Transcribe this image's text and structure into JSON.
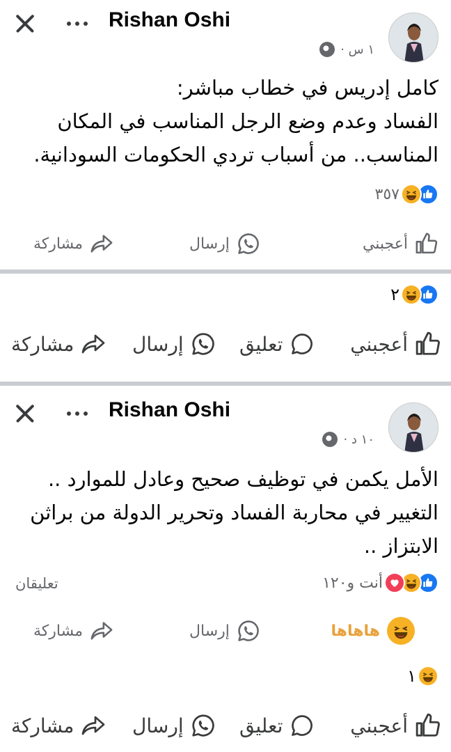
{
  "posts": [
    {
      "author": "Rishan Oshi",
      "time": "١ س ·",
      "text_lines": [
        "كامل إدريس في خطاب مباشر:",
        "الفساد وعدم وضع الرجل المناسب في المكان",
        "المناسب.. من أسباب تردي الحكومات السودانية."
      ],
      "reaction_count": "٣٥٧",
      "actions": {
        "like": "أعجبني",
        "send": "إرسال",
        "share": "مشاركة"
      }
    },
    {
      "author": "Rishan Oshi",
      "time": "١٠ د ·",
      "text_lines": [
        "الأمل يكمن في توظيف صحيح وعادل للموارد ..",
        "التغيير في محاربة الفساد وتحرير الدولة من براثن",
        "الابتزاز .."
      ],
      "reaction_count": "أنت و١٢٠",
      "comments": "تعليقان",
      "actions": {
        "haha": "هاهاها",
        "send": "إرسال",
        "share": "مشاركة"
      }
    }
  ],
  "feed_bars": [
    {
      "reaction_count": "٢",
      "like": "أعجبني",
      "comment": "تعليق",
      "send": "إرسال",
      "share": "مشاركة"
    },
    {
      "reaction_count": "١",
      "like": "أعجبني",
      "comment": "تعليق",
      "send": "إرسال",
      "share": "مشاركة"
    }
  ],
  "icons": {
    "close": "close-icon",
    "more": "more-icon",
    "globe": "globe-icon",
    "like": "thumbs-up-icon",
    "haha": "haha-emoji-icon",
    "love": "heart-icon",
    "send": "whatsapp-icon",
    "share": "share-arrow-icon",
    "comment": "comment-bubble-icon"
  },
  "colors": {
    "like_blue": "#1877f2",
    "haha_yellow": "#f7b125",
    "love_red": "#f33e58",
    "muted": "#65676b",
    "haha_label": "#e9a13b"
  }
}
